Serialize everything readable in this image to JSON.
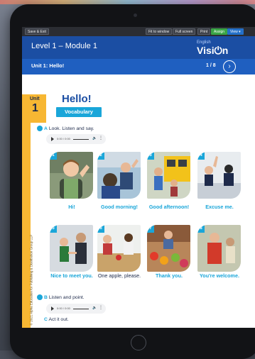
{
  "toolbar": {
    "save_exit": "Save & Exit",
    "fit_window": "Fit to window",
    "full_screen": "Full screen",
    "print": "Print",
    "assign": "Assign",
    "view": "View ▾"
  },
  "header": {
    "module_title": "Level 1 – Module 1",
    "brand_top": "English",
    "brand_main": "Visi⏻n"
  },
  "unit_bar": {
    "title": "Unit 1: Hello!",
    "page": "1 / 8",
    "next_icon": "›"
  },
  "page": {
    "unit_word": "Unit",
    "unit_number": "1",
    "heading": "Hello!",
    "section_tag": "Vocabulary",
    "copyright": "© 2021 Alpha Education for Publishing & Distribution Group LLP"
  },
  "exercise_a": {
    "track": "1.01",
    "letter": "A",
    "text": "Look. Listen and say.",
    "audio_time": "0:00 / 0:00"
  },
  "exercise_b": {
    "track": "1.02",
    "letter": "B",
    "text": "Listen and point.",
    "audio_time": "0:00 / 0:00"
  },
  "exercise_c": {
    "letter": "C",
    "text": "Act it out."
  },
  "cards": [
    {
      "num": "1",
      "caption": "Hi!"
    },
    {
      "num": "2",
      "caption": "Good morning!"
    },
    {
      "num": "3",
      "caption": "Good afternoon!"
    },
    {
      "num": "4",
      "caption": "Excuse me."
    },
    {
      "num": "5",
      "caption": "Nice to meet you."
    },
    {
      "num": "6",
      "caption": "One apple, please."
    },
    {
      "num": "7",
      "caption": "Thank you."
    },
    {
      "num": "8",
      "caption": "You're welcome."
    }
  ],
  "colors": {
    "primary": "#1b4ea3",
    "accent": "#1aa6d9",
    "yellow": "#f7b733",
    "assign": "#3aa546"
  }
}
